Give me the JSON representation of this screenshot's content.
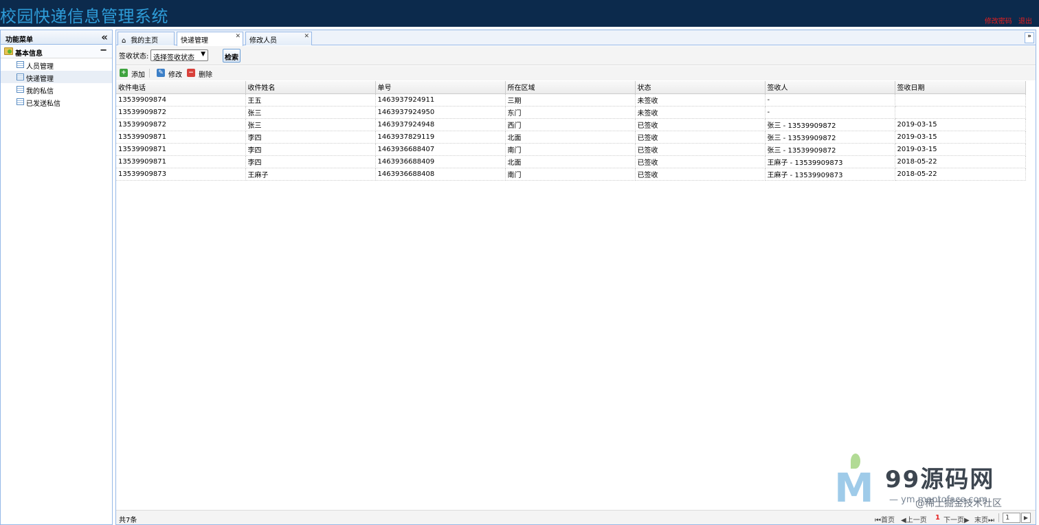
{
  "header": {
    "title": "校园快递信息管理系统",
    "change_password": "修改密码",
    "logout": "退出"
  },
  "sidebar": {
    "title": "功能菜单",
    "group": "基本信息",
    "items": [
      {
        "label": "人员管理"
      },
      {
        "label": "快递管理"
      },
      {
        "label": "我的私信"
      },
      {
        "label": "已发送私信"
      }
    ]
  },
  "tabs": [
    {
      "label": "我的主页"
    },
    {
      "label": "快递管理"
    },
    {
      "label": "修改人员"
    }
  ],
  "search": {
    "label": "签收状态:",
    "select_value": "选择签收状态",
    "button": "检索"
  },
  "toolbar": {
    "add": "添加",
    "edit": "修改",
    "delete": "删除"
  },
  "table": {
    "columns": [
      "收件电话",
      "收件姓名",
      "单号",
      "所在区域",
      "状态",
      "签收人",
      "签收日期"
    ],
    "rows": [
      [
        "13539909874",
        "王五",
        "1463937924911",
        "三期",
        "未签收",
        "-",
        ""
      ],
      [
        "13539909872",
        "张三",
        "1463937924950",
        "东门",
        "未签收",
        "-",
        ""
      ],
      [
        "13539909872",
        "张三",
        "1463937924948",
        "西门",
        "已签收",
        "张三 - 13539909872",
        "2019-03-15"
      ],
      [
        "13539909871",
        "李四",
        "1463937829119",
        "北面",
        "已签收",
        "张三 - 13539909872",
        "2019-03-15"
      ],
      [
        "13539909871",
        "李四",
        "1463936688407",
        "南门",
        "已签收",
        "张三 - 13539909872",
        "2019-03-15"
      ],
      [
        "13539909871",
        "李四",
        "1463936688409",
        "北面",
        "已签收",
        "王麻子 - 13539909873",
        "2018-05-22"
      ],
      [
        "13539909873",
        "王麻子",
        "1463936688408",
        "南门",
        "已签收",
        "王麻子 - 13539909873",
        "2018-05-22"
      ]
    ]
  },
  "footer": {
    "total": "共7条",
    "first": "首页",
    "prev": "上一页",
    "current_page": "1",
    "next": "下一页",
    "last": "末页",
    "page_input": "1"
  },
  "watermark": {
    "logo_letter": "M",
    "brand": "99源码网",
    "sub": "— ym.maptoface.com",
    "sub2": "@稀土掘金技术社区"
  }
}
